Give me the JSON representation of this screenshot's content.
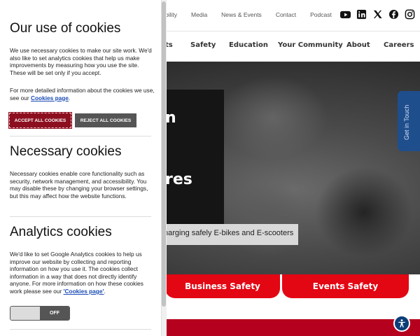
{
  "site": {
    "utility_nav": [
      "bility",
      "Media",
      "News & Events",
      "Contact",
      "Podcast"
    ],
    "social_icons": [
      "youtube-icon",
      "linkedin-icon",
      "x-icon",
      "facebook-icon",
      "instagram-icon"
    ],
    "main_nav": [
      "ts",
      "Safety",
      "Education",
      "Your Community",
      "About",
      "Careers"
    ],
    "hero_text_1": "n",
    "hero_text_2": "res",
    "hero_caption": "harging safely E-bikes and E-scooters",
    "get_in_touch": "Get in Touch",
    "quick_links": [
      "Business Safety",
      "Events Safety"
    ],
    "accent_color": "#e30613"
  },
  "cookies": {
    "title": "Our use of cookies",
    "intro": "We use necessary cookies to make our site work. We'd also like to set analytics cookies that help us make improvements by measuring how you use the site. These will be set only if you accept.",
    "more_info_prefix": "For more detailed information about the cookies we use, see our ",
    "more_info_link": "Cookies page",
    "more_info_suffix": ".",
    "accept_label": "ACCEPT ALL COOKIES",
    "reject_label": "REJECT ALL COOKIES",
    "necessary_title": "Necessary cookies",
    "necessary_text": "Necessary cookies enable core functionality such as security, network management, and accessibility. You may disable these by changing your browser settings, but this may affect how the website functions.",
    "analytics_title": "Analytics cookies",
    "analytics_text_prefix": "We'd like to set Google Analytics cookies to help us improve our website by collecting and reporting information on how you use it. The cookies collect information in a way that does not directly identify anyone. For more information on how these cookies work please see our ",
    "analytics_link": "'Cookies page'",
    "analytics_text_suffix": ".",
    "analytics_toggle_label": "OFF"
  }
}
